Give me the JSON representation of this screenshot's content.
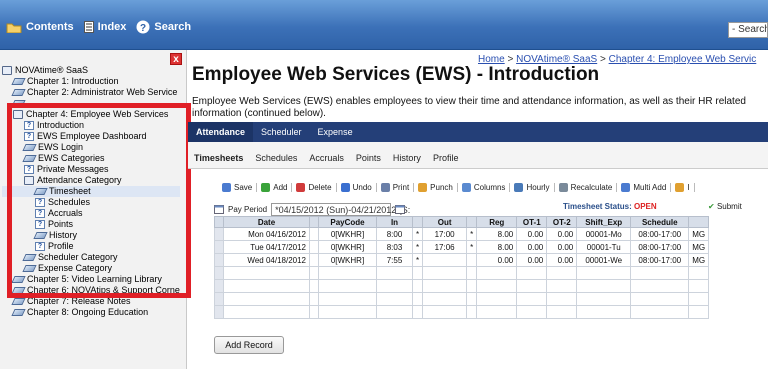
{
  "topbar": {
    "contents": "Contents",
    "index": "Index",
    "search": "Search",
    "search_field": "- Search"
  },
  "tree": [
    {
      "label": "NOVAtime® SaaS",
      "icon": "book",
      "indent": 0
    },
    {
      "label": "Chapter 1: Introduction",
      "icon": "topic",
      "indent": 1
    },
    {
      "label": "Chapter 2: Administrator Web Service",
      "icon": "topic",
      "indent": 1
    },
    {
      "label": "",
      "icon": "topic",
      "indent": 1
    },
    {
      "label": "Chapter 4: Employee Web Services",
      "icon": "book",
      "indent": 1
    },
    {
      "label": "Introduction",
      "icon": "help",
      "indent": 2
    },
    {
      "label": "EWS Employee Dashboard",
      "icon": "help",
      "indent": 2
    },
    {
      "label": "EWS Login",
      "icon": "topic",
      "indent": 2
    },
    {
      "label": "EWS Categories",
      "icon": "topic",
      "indent": 2
    },
    {
      "label": "Private Messages",
      "icon": "help",
      "indent": 2
    },
    {
      "label": "Attendance Category",
      "icon": "book",
      "indent": 2
    },
    {
      "label": "Timesheet",
      "icon": "topic",
      "indent": 3,
      "selected": true
    },
    {
      "label": "Schedules",
      "icon": "help",
      "indent": 3
    },
    {
      "label": "Accruals",
      "icon": "help",
      "indent": 3
    },
    {
      "label": "Points",
      "icon": "help",
      "indent": 3
    },
    {
      "label": "History",
      "icon": "topic",
      "indent": 3
    },
    {
      "label": "Profile",
      "icon": "help",
      "indent": 3
    },
    {
      "label": "Scheduler Category",
      "icon": "topic",
      "indent": 2
    },
    {
      "label": "Expense Category",
      "icon": "topic",
      "indent": 2
    },
    {
      "label": "Chapter 5: Video Learning Library",
      "icon": "topic",
      "indent": 1
    },
    {
      "label": "Chapter 6: NOVAtips & Support Corne",
      "icon": "topic",
      "indent": 1
    },
    {
      "label": "Chapter 7: Release Notes",
      "icon": "topic",
      "indent": 1
    },
    {
      "label": "Chapter 8: Ongoing Education",
      "icon": "topic",
      "indent": 1
    }
  ],
  "breadcrumb": {
    "home": "Home",
    "sep": " > ",
    "saas": "NOVAtime® SaaS",
    "chapter": "Chapter 4: Employee Web Servic"
  },
  "title": "Employee Web Services (EWS) - Introduction",
  "description": "Employee Web Services (EWS) enables employees to view their time and attendance information, as well as their HR related information (continued below).",
  "main_tabs": [
    "Attendance",
    "Scheduler",
    "Expense"
  ],
  "sub_tabs": [
    "Timesheets",
    "Schedules",
    "Accruals",
    "Points",
    "History",
    "Profile"
  ],
  "toolbar": [
    {
      "label": "Save",
      "color": "#4b7bd0"
    },
    {
      "label": "Add",
      "color": "#3aa33a"
    },
    {
      "label": "Delete",
      "color": "#d03b3b"
    },
    {
      "label": "Undo",
      "color": "#3a6fd0"
    },
    {
      "label": "Print",
      "color": "#6a7fa8"
    },
    {
      "label": "Punch",
      "color": "#e0a030"
    },
    {
      "label": "Columns",
      "color": "#5a8ad0"
    },
    {
      "label": "Hourly",
      "color": "#4a7ab8"
    },
    {
      "label": "Recalculate",
      "color": "#7a8a9a"
    },
    {
      "label": "Multi Add",
      "color": "#4b7bd0"
    },
    {
      "label": "I",
      "color": "#e0a030"
    }
  ],
  "pay_period": {
    "label": "Pay Period",
    "value": "*04/15/2012 (Sun)-04/21/2012 (S:"
  },
  "status": {
    "label": "Timesheet Status:",
    "value": "OPEN"
  },
  "submit": "Submit",
  "table": {
    "headers": [
      "",
      "Date",
      "",
      "PayCode",
      "In",
      "",
      "Out",
      "",
      "Reg",
      "OT-1",
      "OT-2",
      "Shift_Exp",
      "Schedule",
      ""
    ],
    "rows": [
      [
        "",
        "Mon 04/16/2012",
        "",
        "0[WKHR]",
        "8:00",
        "*",
        "17:00",
        "*",
        "8.00",
        "0.00",
        "0.00",
        "00001-Mo",
        "08:00-17:00",
        "MG"
      ],
      [
        "",
        "Tue 04/17/2012",
        "",
        "0[WKHR]",
        "8:03",
        "*",
        "17:06",
        "*",
        "8.00",
        "0.00",
        "0.00",
        "00001-Tu",
        "08:00-17:00",
        "MG"
      ],
      [
        "",
        "Wed 04/18/2012",
        "",
        "0[WKHR]",
        "7:55",
        "*",
        "",
        "",
        "0.00",
        "0.00",
        "0.00",
        "00001-We",
        "08:00-17:00",
        "MG"
      ]
    ]
  },
  "add_record": "Add Record"
}
